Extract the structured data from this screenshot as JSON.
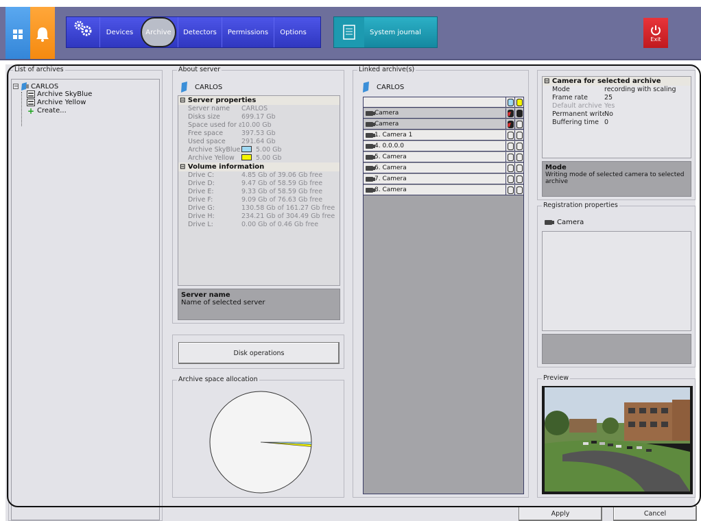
{
  "toolbar": {
    "tabs": [
      "Devices",
      "Archive",
      "Detectors",
      "Permissions",
      "Options"
    ],
    "active_tab": "Archive",
    "journal_label": "System journal",
    "exit_label": "Exit"
  },
  "archives_list": {
    "title": "List of archives",
    "server": "CARLOS",
    "items": [
      "Archive SkyBlue",
      "Archive Yellow"
    ],
    "create_label": "Create..."
  },
  "about_server": {
    "title": "About server",
    "server": "CARLOS",
    "server_properties_header": "Server properties",
    "server_properties": [
      {
        "name": "Server name",
        "value": "CARLOS"
      },
      {
        "name": "Disks size",
        "value": "699.17 Gb"
      },
      {
        "name": "Space used for arch",
        "value": "10.00 Gb"
      },
      {
        "name": "Free space",
        "value": "397.53 Gb"
      },
      {
        "name": "Used space",
        "value": "291.64 Gb"
      },
      {
        "name": "Archive SkyBlue",
        "value": "5.00 Gb"
      },
      {
        "name": "Archive Yellow",
        "value": "5.00 Gb"
      }
    ],
    "volume_header": "Volume information",
    "volumes": [
      {
        "name": "Drive C:",
        "value": "4.85 Gb of 39.06 Gb free"
      },
      {
        "name": "Drive D:",
        "value": "9.47 Gb of 58.59 Gb free"
      },
      {
        "name": "Drive E:",
        "value": "9.33 Gb of 58.59 Gb free"
      },
      {
        "name": "Drive F:",
        "value": "9.09 Gb of 76.63 Gb free"
      },
      {
        "name": "Drive G:",
        "value": "130.58 Gb of 161.27 Gb free"
      },
      {
        "name": "Drive H:",
        "value": "234.21 Gb of 304.49 Gb free"
      },
      {
        "name": "Drive L:",
        "value": "0.00 Gb of 0.46 Gb free"
      }
    ],
    "desc_title": "Server name",
    "desc_text": "Name of selected server",
    "disk_ops_label": "Disk operations",
    "alloc_title": "Archive space allocation",
    "alloc_fractions": {
      "free": 0.986,
      "skyblue": 0.007,
      "yellow": 0.007
    }
  },
  "linked": {
    "title": "Linked archive(s)",
    "server": "CARLOS",
    "cameras": [
      "Camera",
      "Camera",
      "1. Camera 1",
      "4. 0.0.0.0",
      "5. Camera",
      "6. Camera",
      "7. Camera",
      "8. Camera"
    ],
    "selected_rows": [
      0,
      1
    ]
  },
  "camera_props": {
    "header": "Camera for selected archive",
    "rows": [
      {
        "name": "Mode",
        "value": "recording with scaling"
      },
      {
        "name": "Frame rate",
        "value": "25"
      },
      {
        "name": "Default archive",
        "value": "Yes"
      },
      {
        "name": "Permanent write",
        "value": "No"
      },
      {
        "name": "Buffering time",
        "value": "0"
      }
    ],
    "desc_title": "Mode",
    "desc_text": "Writing mode of selected camera to selected archive"
  },
  "registration": {
    "title": "Registration properties",
    "camera": "Camera"
  },
  "preview": {
    "title": "Preview"
  },
  "footer": {
    "apply": "Apply",
    "cancel": "Cancel"
  },
  "colors": {
    "skyblue": "#9fd9f3",
    "yellow": "#f5f500",
    "toolbar_blue": "#3b42d6",
    "journal_teal": "#1f9fb5",
    "exit_red": "#d9262c"
  }
}
